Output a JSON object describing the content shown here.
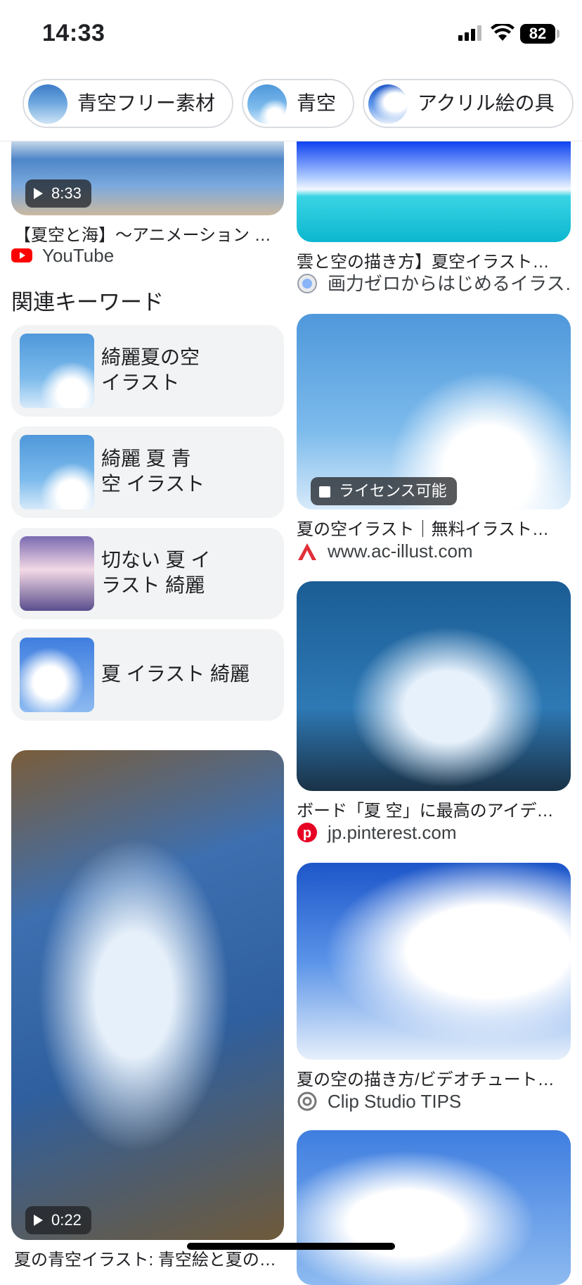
{
  "status": {
    "time": "14:33",
    "battery": "82"
  },
  "chips": [
    {
      "label": "青空フリー素材"
    },
    {
      "label": "青空"
    },
    {
      "label": "アクリル絵の具"
    }
  ],
  "left": {
    "video1": {
      "duration": "8:33",
      "title": "【夏空と海】〜アニメーション …",
      "source": "YouTube"
    },
    "related_heading": "関連キーワード",
    "keywords": [
      {
        "line1": "綺麗夏の空",
        "line2": "イラスト"
      },
      {
        "line1": "綺麗 夏 青",
        "line2": "空 イラスト"
      },
      {
        "line1": "切ない 夏 イ",
        "line2": "ラスト 綺麗"
      },
      {
        "line1": "夏 イラスト 綺麗",
        "line2": ""
      }
    ],
    "video2": {
      "duration": "0:22",
      "title": "夏の青空イラスト: 青空絵と夏の…"
    }
  },
  "right": {
    "r1": {
      "title": "雲と空の描き方】夏空イラスト…",
      "source": "画力ゼロからはじめるイラス…"
    },
    "r2": {
      "badge": "ライセンス可能",
      "title": "夏の空イラスト｜無料イラスト…",
      "source": "www.ac-illust.com"
    },
    "r3": {
      "title": "ボード「夏 空」に最高のアイデ…",
      "source": "jp.pinterest.com"
    },
    "r4": {
      "title": "夏の空の描き方/ビデオチュート…",
      "source": "Clip Studio TIPS"
    }
  },
  "colors": {
    "youtube": "#ff0000",
    "pinterest": "#e60023",
    "ac_illust": "#e0303a"
  }
}
